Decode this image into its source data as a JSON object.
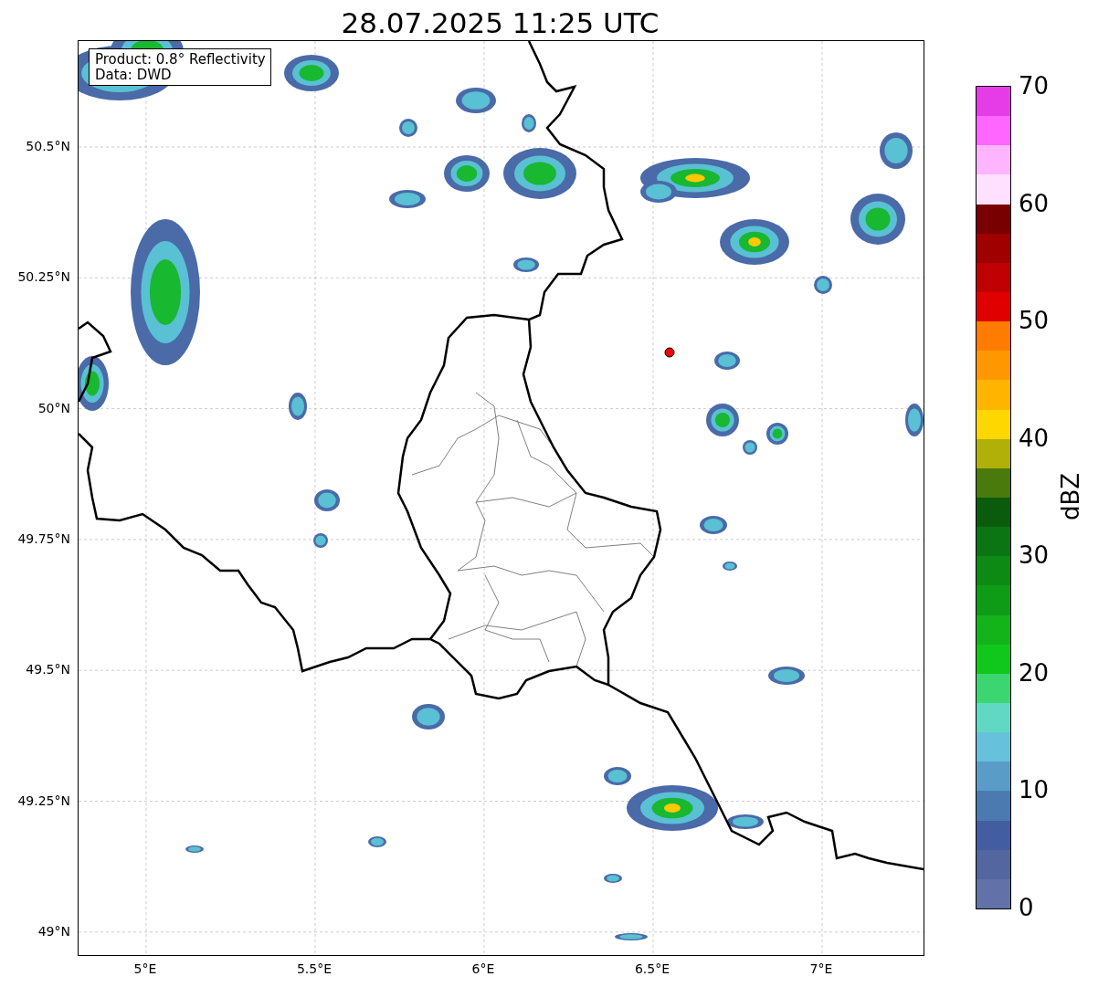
{
  "title": "28.07.2025 11:25 UTC",
  "info_lines": [
    "Product: 0.8° Reflectivity",
    "Data: DWD"
  ],
  "map": {
    "x_ticks": [
      "5°E",
      "5.5°E",
      "6°E",
      "6.5°E",
      "7°E"
    ],
    "y_ticks": [
      "50.5°N",
      "50.25°N",
      "50°N",
      "49.75°N",
      "49.5°N",
      "49.25°N",
      "49°N"
    ]
  },
  "colorbar": {
    "label": "dBZ",
    "ticks": [
      "70",
      "60",
      "50",
      "40",
      "30",
      "20",
      "10",
      "0"
    ],
    "segments": [
      {
        "color": "#e63ce8"
      },
      {
        "color": "#ff66ff"
      },
      {
        "color": "#ffb4ff"
      },
      {
        "color": "#ffe0ff"
      },
      {
        "color": "#780000"
      },
      {
        "color": "#a00000"
      },
      {
        "color": "#c00000"
      },
      {
        "color": "#e00000"
      },
      {
        "color": "#ff7c00"
      },
      {
        "color": "#ff9800"
      },
      {
        "color": "#ffb400"
      },
      {
        "color": "#ffd700"
      },
      {
        "color": "#b0b008"
      },
      {
        "color": "#4a7a0c"
      },
      {
        "color": "#0a5c0c"
      },
      {
        "color": "#0b7514"
      },
      {
        "color": "#0c8a14"
      },
      {
        "color": "#0e9c16"
      },
      {
        "color": "#12b41a"
      },
      {
        "color": "#10c81c"
      },
      {
        "color": "#3cd670"
      },
      {
        "color": "#60d8c4"
      },
      {
        "color": "#66c2dc"
      },
      {
        "color": "#5a9cc8"
      },
      {
        "color": "#4a7ab0"
      },
      {
        "color": "#435ea0"
      },
      {
        "color": "#5466a0"
      },
      {
        "color": "#6272a8"
      }
    ]
  }
}
